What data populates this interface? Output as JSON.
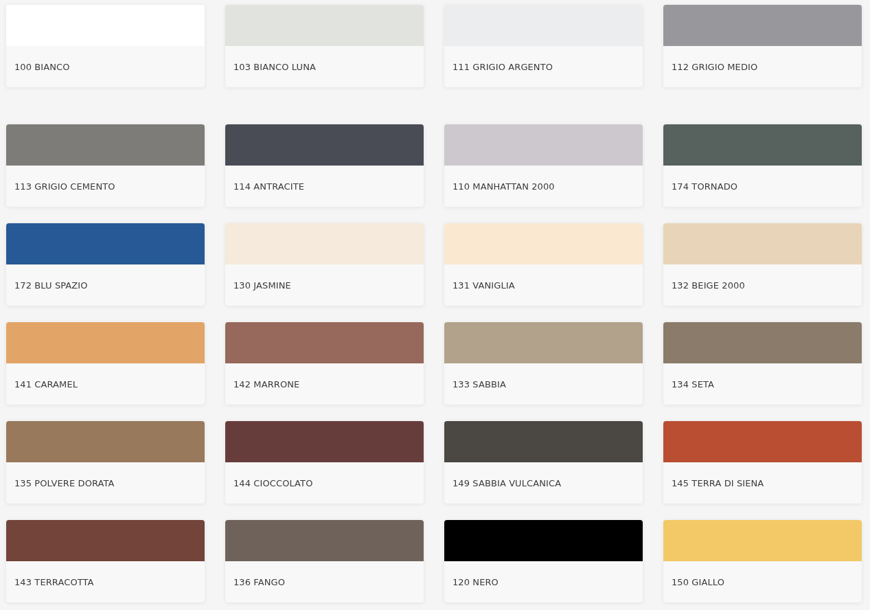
{
  "groups": [
    {
      "swatches": [
        {
          "label": "100 BIANCO",
          "color": "#ffffff"
        },
        {
          "label": "103 BIANCO LUNA",
          "color": "#e1e3de"
        },
        {
          "label": "111 GRIGIO ARGENTO",
          "color": "#ecedef"
        },
        {
          "label": "112 GRIGIO MEDIO",
          "color": "#98979c"
        }
      ]
    },
    {
      "swatches": [
        {
          "label": "113 GRIGIO CEMENTO",
          "color": "#7e7c78"
        },
        {
          "label": "114 ANTRACITE",
          "color": "#494c54"
        },
        {
          "label": "110 MANHATTAN 2000",
          "color": "#cdc8cd"
        },
        {
          "label": "174 TORNADO",
          "color": "#57615e"
        },
        {
          "label": "172 BLU SPAZIO",
          "color": "#275996"
        },
        {
          "label": "130 JASMINE",
          "color": "#f5eadb"
        },
        {
          "label": "131 VANIGLIA",
          "color": "#fbe8d0"
        },
        {
          "label": "132 BEIGE 2000",
          "color": "#e8d4b8"
        },
        {
          "label": "141 CARAMEL",
          "color": "#e2a467"
        },
        {
          "label": "142 MARRONE",
          "color": "#96695c"
        },
        {
          "label": "133 SABBIA",
          "color": "#b2a28b"
        },
        {
          "label": "134 SETA",
          "color": "#8b7b6a"
        },
        {
          "label": "135 POLVERE DORATA",
          "color": "#98795b"
        },
        {
          "label": "144 CIOCCOLATO",
          "color": "#673d3c"
        },
        {
          "label": "149 SABBIA VULCANICA",
          "color": "#4b4743"
        },
        {
          "label": "145 TERRA DI SIENA",
          "color": "#b94e33"
        },
        {
          "label": "143 TERRACOTTA",
          "color": "#72443a"
        },
        {
          "label": "136 FANGO",
          "color": "#6f625a"
        },
        {
          "label": "120 NERO",
          "color": "#000000"
        },
        {
          "label": "150 GIALLO",
          "color": "#f2c966"
        }
      ]
    }
  ]
}
